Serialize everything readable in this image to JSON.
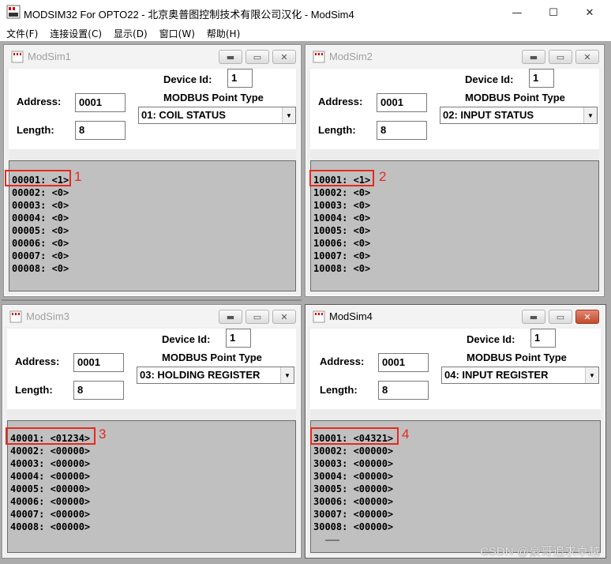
{
  "window": {
    "title": "MODSIM32 For OPTO22 - 北京奥普图控制技术有限公司汉化 - ModSim4",
    "minimize": "—",
    "maximize": "☐",
    "close": "✕"
  },
  "menu": [
    "文件(F)",
    "连接设置(C)",
    "显示(D)",
    "窗口(W)",
    "帮助(H)"
  ],
  "labels": {
    "device_id": "Device Id:",
    "point_type": "MODBUS Point Type",
    "address": "Address:",
    "length": "Length:"
  },
  "children": [
    {
      "title": "ModSim1",
      "active": false,
      "device_id": "1",
      "address": "0001",
      "length": "8",
      "point_type": "01: COIL STATUS",
      "lines": [
        "00001: <1>",
        "00002: <0>",
        "00003: <0>",
        "00004: <0>",
        "00005: <0>",
        "00006: <0>",
        "00007: <0>",
        "00008: <0>"
      ],
      "marker": "1"
    },
    {
      "title": "ModSim2",
      "active": false,
      "device_id": "1",
      "address": "0001",
      "length": "8",
      "point_type": "02: INPUT STATUS",
      "lines": [
        "10001: <1>",
        "10002: <0>",
        "10003: <0>",
        "10004: <0>",
        "10005: <0>",
        "10006: <0>",
        "10007: <0>",
        "10008: <0>"
      ],
      "marker": "2"
    },
    {
      "title": "ModSim3",
      "active": false,
      "device_id": "1",
      "address": "0001",
      "length": "8",
      "point_type": "03: HOLDING REGISTER",
      "lines": [
        "40001: <01234>",
        "40002: <00000>",
        "40003: <00000>",
        "40004: <00000>",
        "40005: <00000>",
        "40006: <00000>",
        "40007: <00000>",
        "40008: <00000>"
      ],
      "marker": "3"
    },
    {
      "title": "ModSim4",
      "active": true,
      "device_id": "1",
      "address": "0001",
      "length": "8",
      "point_type": "04: INPUT REGISTER",
      "lines": [
        "30001: <04321>",
        "30002: <00000>",
        "30003: <00000>",
        "30004: <00000>",
        "30005: <00000>",
        "30006: <00000>",
        "30007: <00000>",
        "30008: <00000>"
      ],
      "marker": "4"
    }
  ],
  "child_buttons": {
    "minimize": "▬",
    "maximize": "▭",
    "close": "✕"
  },
  "dropdown_arrow": "▼",
  "watermark": "CSDN @豪哥追求卓越",
  "colors": {
    "highlight": "#e8281e",
    "data_background": "#c0c0c0",
    "mdi_background": "#ababab"
  }
}
